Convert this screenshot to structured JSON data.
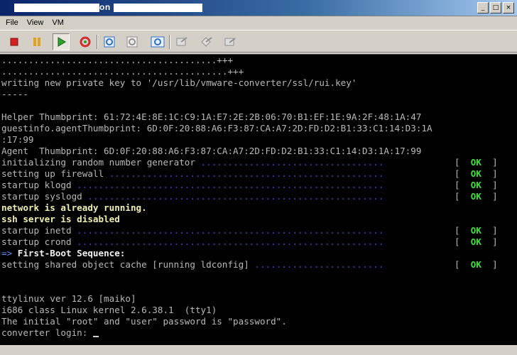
{
  "window": {
    "title": "on",
    "buttons": {
      "minimize": "_",
      "maximize": "□",
      "close": "×"
    }
  },
  "menu": [
    "File",
    "View",
    "VM"
  ],
  "toolbar": [
    {
      "name": "power-off-icon",
      "color": "#d42020"
    },
    {
      "name": "suspend-icon",
      "color": "#e0a020"
    },
    {
      "name": "power-on-icon",
      "color": "#30a030"
    },
    {
      "name": "reset-icon",
      "color": "#d03030"
    },
    {
      "name": "snapshot-icon",
      "color": "#3070c0"
    },
    {
      "name": "revert-snapshot-icon",
      "color": "#909090"
    },
    {
      "name": "snapshot-manager-icon",
      "color": "#3070c0"
    },
    {
      "name": "fullscreen-icon",
      "color": "#909090"
    },
    {
      "name": "unity-icon",
      "color": "#909090"
    },
    {
      "name": "preferences-icon",
      "color": "#909090"
    }
  ],
  "console": {
    "lines": [
      {
        "text": "........................................+++",
        "style": "normal"
      },
      {
        "text": "..........................................+++",
        "style": "normal"
      },
      {
        "text": "writing new private key to '/usr/lib/vmware-converter/ssl/rui.key'",
        "style": "normal"
      },
      {
        "text": "-----",
        "style": "normal"
      },
      {
        "text": "",
        "style": "normal"
      },
      {
        "text": "Helper Thumbprint: 61:72:4E:8E:1C:C9:1A:E7:2E:2B:06:70:B1:EF:1E:9A:2F:48:1A:47",
        "style": "normal"
      },
      {
        "text": "guestinfo.agentThumbprint: 6D:0F:20:88:A6:F3:87:CA:A7:2D:FD:D2:B1:33:C1:14:D3:1A",
        "style": "normal"
      },
      {
        "text": ":17:99",
        "style": "normal"
      },
      {
        "text": "Agent  Thumbprint: 6D:0F:20:88:A6:F3:87:CA:A7:2D:FD:D2:B1:33:C1:14:D3:1A:17:99",
        "style": "normal"
      },
      {
        "text": "initializing random number generator",
        "style": "normal",
        "dots": " ..................................",
        "status": "OK"
      },
      {
        "text": "setting up firewall",
        "style": "normal",
        "dots": " ...................................................",
        "status": "OK"
      },
      {
        "text": "startup klogd",
        "style": "normal",
        "dots": " .........................................................",
        "status": "OK"
      },
      {
        "text": "startup syslogd",
        "style": "normal",
        "dots": " .......................................................",
        "status": "OK"
      },
      {
        "text": "network is already running.",
        "style": "yellow"
      },
      {
        "text": "ssh server is disabled",
        "style": "yellow"
      },
      {
        "text": "startup inetd",
        "style": "normal",
        "dots": " .........................................................",
        "status": "OK"
      },
      {
        "text": "startup crond",
        "style": "normal",
        "dots": " .........................................................",
        "status": "OK"
      },
      {
        "text": "First-Boot Sequence:",
        "style": "sequence",
        "arrow": "=>"
      },
      {
        "text": "setting shared object cache [running ldconfig]",
        "style": "normal",
        "dots": " ........................",
        "status": "OK"
      },
      {
        "text": "",
        "style": "normal"
      },
      {
        "text": "",
        "style": "normal"
      },
      {
        "text": "ttylinux ver 12.6 [maiko]",
        "style": "normal"
      },
      {
        "text": "i686 class Linux kernel 2.6.38.1  (tty1)",
        "style": "normal"
      },
      {
        "text": "The initial \"root\" and \"user\" password is \"password\".",
        "style": "normal"
      },
      {
        "text": "converter login: ",
        "style": "normal",
        "cursor": true
      }
    ]
  }
}
